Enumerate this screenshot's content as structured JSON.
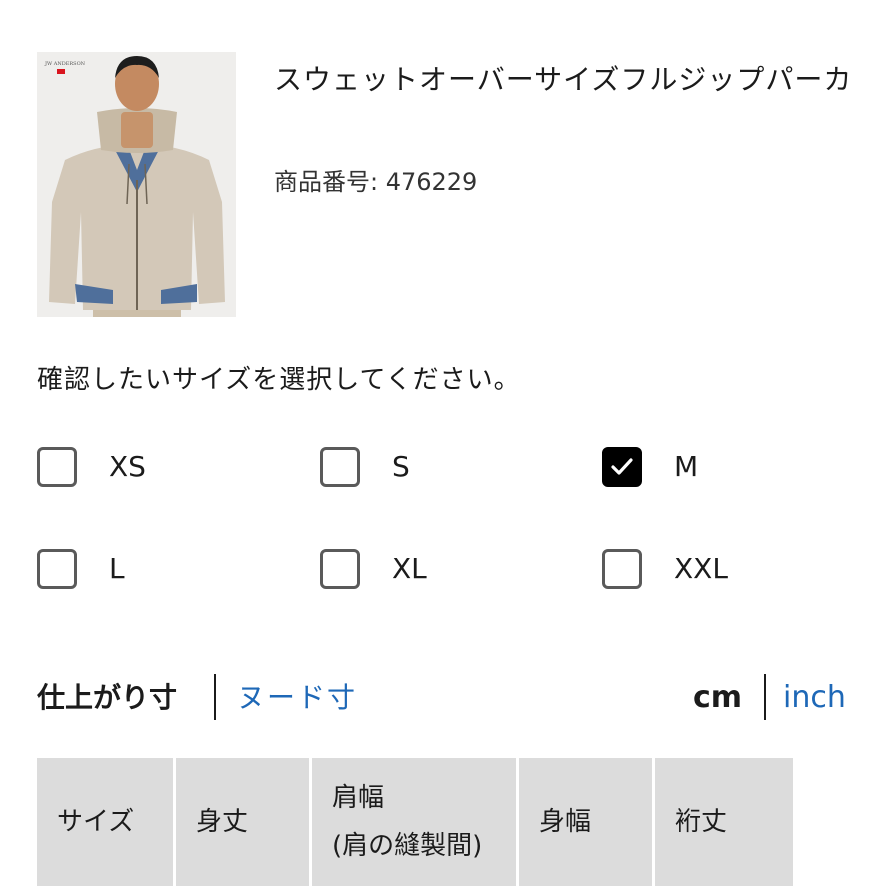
{
  "product": {
    "brand_mark": "JW ANDERSON",
    "title": "スウェットオーバーサイズフルジップパーカ",
    "number": "商品番号: 476229"
  },
  "size_selector": {
    "instruction": "確認したいサイズを選択してください。",
    "options": [
      {
        "label": "XS",
        "checked": false
      },
      {
        "label": "S",
        "checked": false
      },
      {
        "label": "M",
        "checked": true
      },
      {
        "label": "L",
        "checked": false
      },
      {
        "label": "XL",
        "checked": false
      },
      {
        "label": "XXL",
        "checked": false
      }
    ]
  },
  "measure_tabs": {
    "active": "仕上がり寸",
    "inactive": "ヌード寸"
  },
  "units": {
    "active": "cm",
    "inactive": "inch"
  },
  "table": {
    "headers": [
      "サイズ",
      "身丈",
      "肩幅",
      "(肩の縫製間)",
      "身幅",
      "裄丈"
    ]
  },
  "colors": {
    "link": "#1e68b7",
    "header_bg": "#dcdcdc",
    "checked_bg": "#000000"
  }
}
